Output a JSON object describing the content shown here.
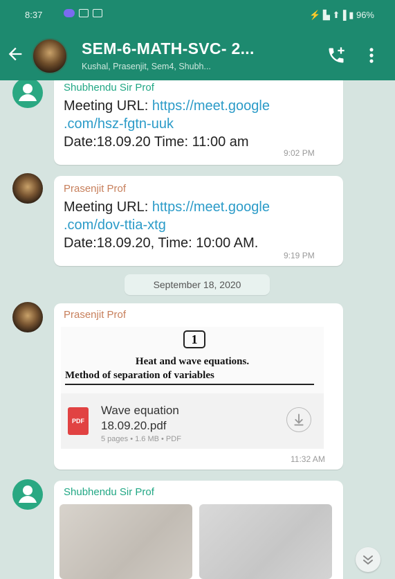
{
  "status_bar": {
    "time": "8:37",
    "right_status": "⚡ ▙ ⬆▐ ▮ 96%"
  },
  "header": {
    "title": "SEM-6-MATH-SVC- 2...",
    "subtitle": "Kushal, Prasenjit, Sem4, Shubh..."
  },
  "messages": [
    {
      "sender": "Shubhendu Sir Prof",
      "line1_prefix": "Meeting URL: ",
      "line1_link": "https://meet.google",
      "line2_link": ".com/hsz-fgtn-uuk",
      "line3": "Date:18.09.20  Time: 11:00 am",
      "time": "9:02 PM"
    },
    {
      "sender": "Prasenjit Prof",
      "line1_prefix": "Meeting URL: ",
      "line1_link": "https://meet.google",
      "line2_link": ".com/dov-ttia-xtg",
      "line3": "Date:18.09.20, Time: 10:00 AM.",
      "time": "9:19 PM"
    }
  ],
  "date_divider": "September 18, 2020",
  "document_message": {
    "sender": "Prasenjit Prof",
    "preview_number": "1",
    "preview_heading_1": "Heat and wave equations.",
    "preview_heading_2": "Method of separation of variables",
    "file_type_badge": "PDF",
    "file_name_line1": "Wave equation",
    "file_name_line2": "18.09.20.pdf",
    "file_meta": "5 pages • 1.6 MB • PDF",
    "time": "11:32 AM"
  },
  "image_message": {
    "sender": "Shubhendu Sir Prof"
  },
  "colors": {
    "header_bg": "#1d8a6f",
    "chat_bg": "#d6e4e0",
    "link": "#2b9bc8",
    "sender_green": "#21a784",
    "sender_brown": "#c77f5b"
  },
  "icons": [
    "back-arrow-icon",
    "add-call-icon",
    "more-vert-icon",
    "pdf-icon",
    "download-icon",
    "scroll-down-icon",
    "person-icon"
  ]
}
